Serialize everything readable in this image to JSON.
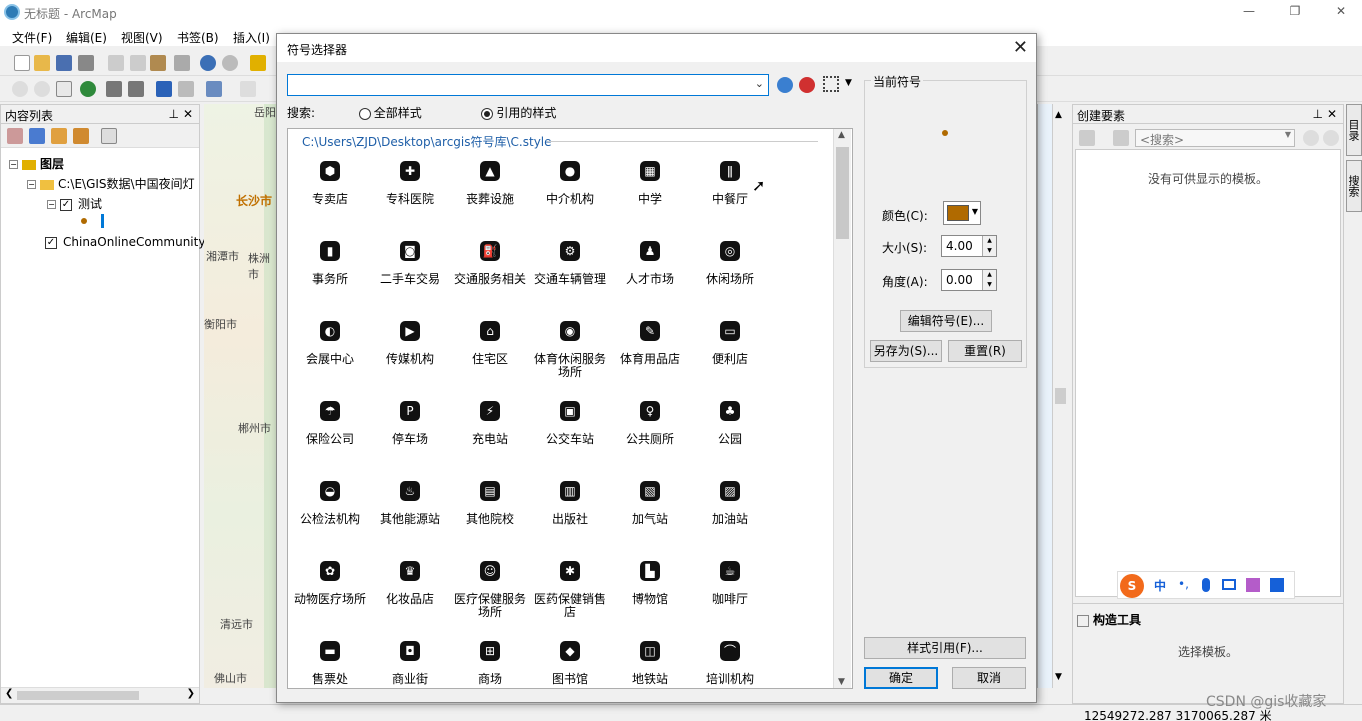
{
  "app": {
    "window_title": "无标题 - ArcMap",
    "menus": [
      "文件(F)",
      "编辑(E)",
      "视图(V)",
      "书签(B)",
      "插入(I)"
    ]
  },
  "toc": {
    "title": "内容列表",
    "layers_root": "图层",
    "folder": "C:\\E\\GIS数据\\中国夜间灯",
    "layer_test": "测试",
    "layer_basemap": "ChinaOnlineCommunity"
  },
  "map": {
    "labels": [
      "岳阳",
      "长沙市",
      "湘潭市",
      "株洲市",
      "衡阳市",
      "郴州市",
      "清远市",
      "佛山市"
    ]
  },
  "create_features": {
    "title": "创建要素",
    "search_placeholder": "<搜索>",
    "empty_message": "没有可供显示的模板。",
    "tools_title": "构造工具",
    "tools_hint": "选择模板。",
    "side_tabs": [
      "目录",
      "搜索"
    ]
  },
  "dialog": {
    "title": "符号选择器",
    "search_label": "搜索:",
    "radio_all": "全部样式",
    "radio_referenced": "引用的样式",
    "style_path": "C:\\Users\\ZJD\\Desktop\\arcgis符号库\\C.style",
    "current_symbol_label": "当前符号",
    "color_label": "颜色(C):",
    "color_value": "#b06a00",
    "size_label": "大小(S):",
    "size_value": "4.00",
    "angle_label": "角度(A):",
    "angle_value": "0.00",
    "edit_symbol": "编辑符号(E)...",
    "save_as": "另存为(S)...",
    "reset": "重置(R)",
    "style_refs": "样式引用(F)...",
    "ok": "确定",
    "cancel": "取消",
    "symbols": [
      {
        "label": "专卖店",
        "icon": "⬢"
      },
      {
        "label": "专科医院",
        "icon": "✚"
      },
      {
        "label": "丧葬设施",
        "icon": "▲"
      },
      {
        "label": "中介机构",
        "icon": "●"
      },
      {
        "label": "中学",
        "icon": "▦"
      },
      {
        "label": "中餐厅",
        "icon": "ǁ"
      },
      {
        "label": "事务所",
        "icon": "▮"
      },
      {
        "label": "二手车交易",
        "icon": "◙"
      },
      {
        "label": "交通服务相关",
        "icon": "⛽"
      },
      {
        "label": "交通车辆管理",
        "icon": "⚙"
      },
      {
        "label": "人才市场",
        "icon": "♟"
      },
      {
        "label": "休闲场所",
        "icon": "◎"
      },
      {
        "label": "会展中心",
        "icon": "◐"
      },
      {
        "label": "传媒机构",
        "icon": "▶"
      },
      {
        "label": "住宅区",
        "icon": "⌂"
      },
      {
        "label": "体育休闲服务场所",
        "icon": "◉"
      },
      {
        "label": "体育用品店",
        "icon": "✎"
      },
      {
        "label": "便利店",
        "icon": "▭"
      },
      {
        "label": "保险公司",
        "icon": "☂"
      },
      {
        "label": "停车场",
        "icon": "P"
      },
      {
        "label": "充电站",
        "icon": "⚡"
      },
      {
        "label": "公交车站",
        "icon": "▣"
      },
      {
        "label": "公共厕所",
        "icon": "♀"
      },
      {
        "label": "公园",
        "icon": "♣"
      },
      {
        "label": "公检法机构",
        "icon": "◒"
      },
      {
        "label": "其他能源站",
        "icon": "♨"
      },
      {
        "label": "其他院校",
        "icon": "▤"
      },
      {
        "label": "出版社",
        "icon": "▥"
      },
      {
        "label": "加气站",
        "icon": "▧"
      },
      {
        "label": "加油站",
        "icon": "▨"
      },
      {
        "label": "动物医疗场所",
        "icon": "✿"
      },
      {
        "label": "化妆品店",
        "icon": "♛"
      },
      {
        "label": "医疗保健服务场所",
        "icon": "☺"
      },
      {
        "label": "医药保健销售店",
        "icon": "✱"
      },
      {
        "label": "博物馆",
        "icon": "▙"
      },
      {
        "label": "咖啡厅",
        "icon": "☕"
      },
      {
        "label": "售票处",
        "icon": "▬"
      },
      {
        "label": "商业街",
        "icon": "◘"
      },
      {
        "label": "商场",
        "icon": "⊞"
      },
      {
        "label": "图书馆",
        "icon": "◆"
      },
      {
        "label": "地铁站",
        "icon": "◫"
      },
      {
        "label": "培训机构",
        "icon": "⌒"
      }
    ]
  },
  "status": {
    "coords": "12549272.287  3170065.287 米",
    "watermark": "CSDN @gis收藏家"
  }
}
